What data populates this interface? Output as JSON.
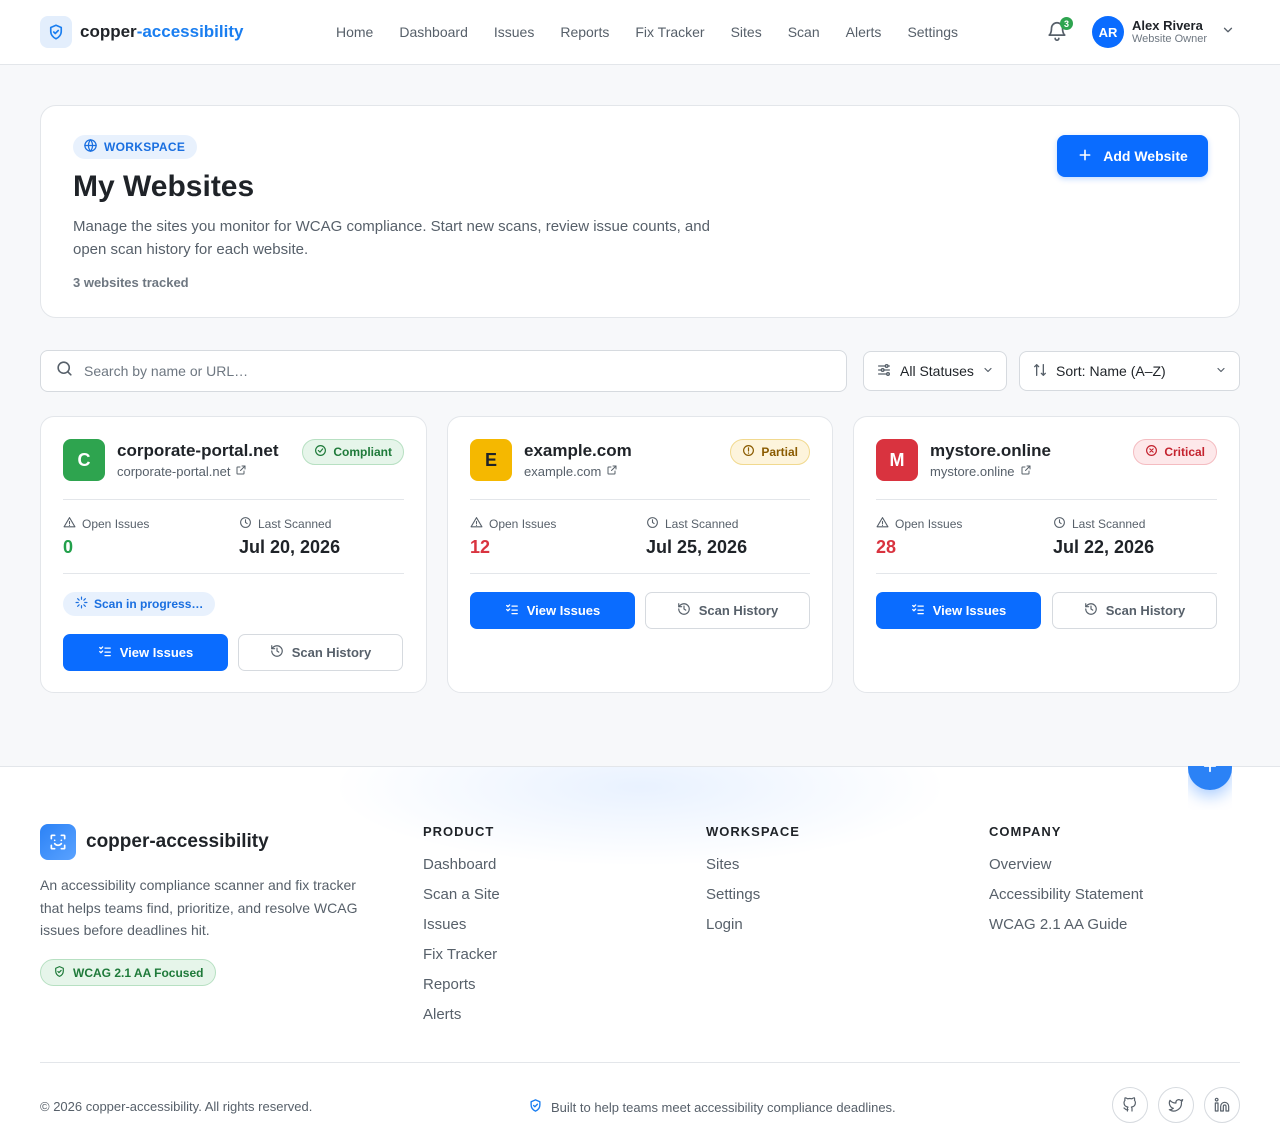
{
  "header": {
    "brand_prefix": "copper",
    "brand_suffix": "-accessibility",
    "nav": [
      "Home",
      "Dashboard",
      "Issues",
      "Reports",
      "Fix Tracker",
      "Sites",
      "Scan",
      "Alerts",
      "Settings"
    ],
    "notification_count": "3",
    "user": {
      "initials": "AR",
      "name": "Alex Rivera",
      "role": "Website Owner"
    }
  },
  "hero": {
    "pill": "WORKSPACE",
    "title": "My Websites",
    "description": "Manage the sites you monitor for WCAG compliance. Start new scans, review issue counts, and open scan history for each website.",
    "count": "3 websites tracked",
    "add_button": "Add Website"
  },
  "filters": {
    "search_placeholder": "Search by name or URL…",
    "status": "All Statuses",
    "sort": "Sort: Name (A–Z)"
  },
  "labels": {
    "open_issues": "Open Issues",
    "last_scanned": "Last Scanned",
    "view_issues": "View Issues",
    "scan_history": "Scan History",
    "scan_in_progress": "Scan in progress…"
  },
  "sites": [
    {
      "initial": "C",
      "name": "corporate-portal.net",
      "url": "corporate-portal.net",
      "status": "Compliant",
      "issues": "0",
      "last_scanned": "Jul 20, 2026",
      "color": "#2ea44f"
    },
    {
      "initial": "E",
      "name": "example.com",
      "url": "example.com",
      "status": "Partial",
      "issues": "12",
      "last_scanned": "Jul 25, 2026",
      "color": "#f5b800"
    },
    {
      "initial": "M",
      "name": "mystore.online",
      "url": "mystore.online",
      "status": "Critical",
      "issues": "28",
      "last_scanned": "Jul 22, 2026",
      "color": "#d9333f"
    }
  ],
  "footer": {
    "brand": "copper-accessibility",
    "description": "An accessibility compliance scanner and fix tracker that helps teams find, prioritize, and resolve WCAG issues before deadlines hit.",
    "badge": "WCAG 2.1 AA Focused",
    "columns": [
      {
        "title": "PRODUCT",
        "links": [
          "Dashboard",
          "Scan a Site",
          "Issues",
          "Fix Tracker",
          "Reports",
          "Alerts"
        ]
      },
      {
        "title": "WORKSPACE",
        "links": [
          "Sites",
          "Settings",
          "Login"
        ]
      },
      {
        "title": "COMPANY",
        "links": [
          "Overview",
          "Accessibility Statement",
          "WCAG 2.1 AA Guide"
        ]
      }
    ],
    "copyright": "© 2026 copper-accessibility. All rights reserved.",
    "tagline": "Built to help teams meet accessibility compliance deadlines.",
    "social_icons": [
      "github-icon",
      "twitter-icon",
      "linkedin-icon"
    ]
  },
  "colors": {
    "primary": "#0a6cff",
    "success": "#22a04b",
    "warning": "#f5b800",
    "danger": "#d9333f"
  }
}
